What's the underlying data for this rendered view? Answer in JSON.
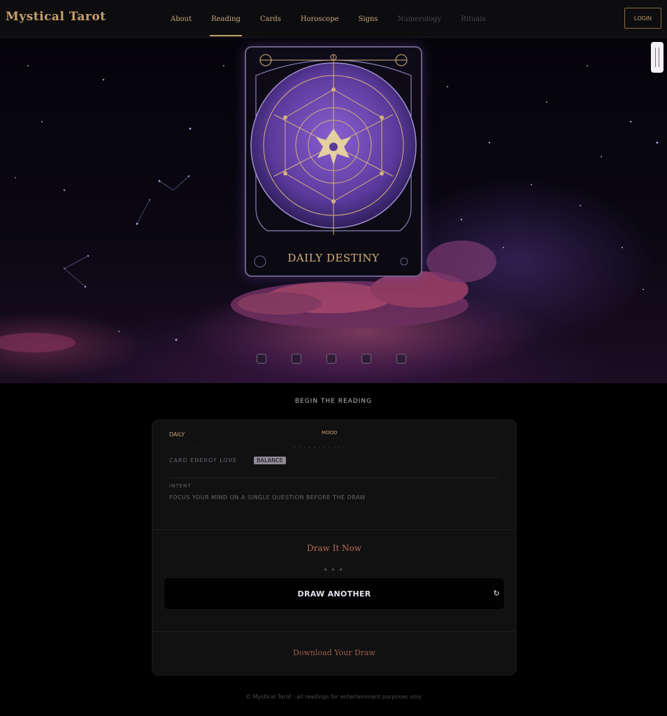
{
  "app": {
    "logo": "Mystical Tarot"
  },
  "nav": {
    "items": [
      {
        "label": "About"
      },
      {
        "label": "Reading"
      },
      {
        "label": "Cards"
      },
      {
        "label": "Horoscope"
      },
      {
        "label": "Signs"
      },
      {
        "label": "Numerology"
      },
      {
        "label": "Rituals"
      }
    ],
    "cta_label": "LOGIN"
  },
  "hero": {
    "card_title": "DAILY DESTINY",
    "colors": {
      "accent": "#c9a06b",
      "purple": "#5b3a9c",
      "cloud": "#b8566f"
    },
    "nav_dots_count": 5
  },
  "section": {
    "title": "BEGIN THE READING"
  },
  "panel": {
    "label_left": "DAILY",
    "label_right": "MOOD",
    "row1_left": "· · · · ·  · ·",
    "row1_right": "· · · · ·   · · · · · ·",
    "row2_text": "CARD ENERGY LOVE",
    "row2_badge": "BALANCE",
    "label_intent": "INTENT",
    "intent_text": "FOCUS YOUR MIND ON A SINGLE QUESTION BEFORE THE DRAW",
    "reveal_label": "Draw It Now",
    "draw_button": "DRAW ANOTHER",
    "draw_icon": "↻",
    "footer_link": "Download Your Draw"
  },
  "footer": {
    "text": "© Mystical Tarot · all readings for entertainment purposes only"
  }
}
